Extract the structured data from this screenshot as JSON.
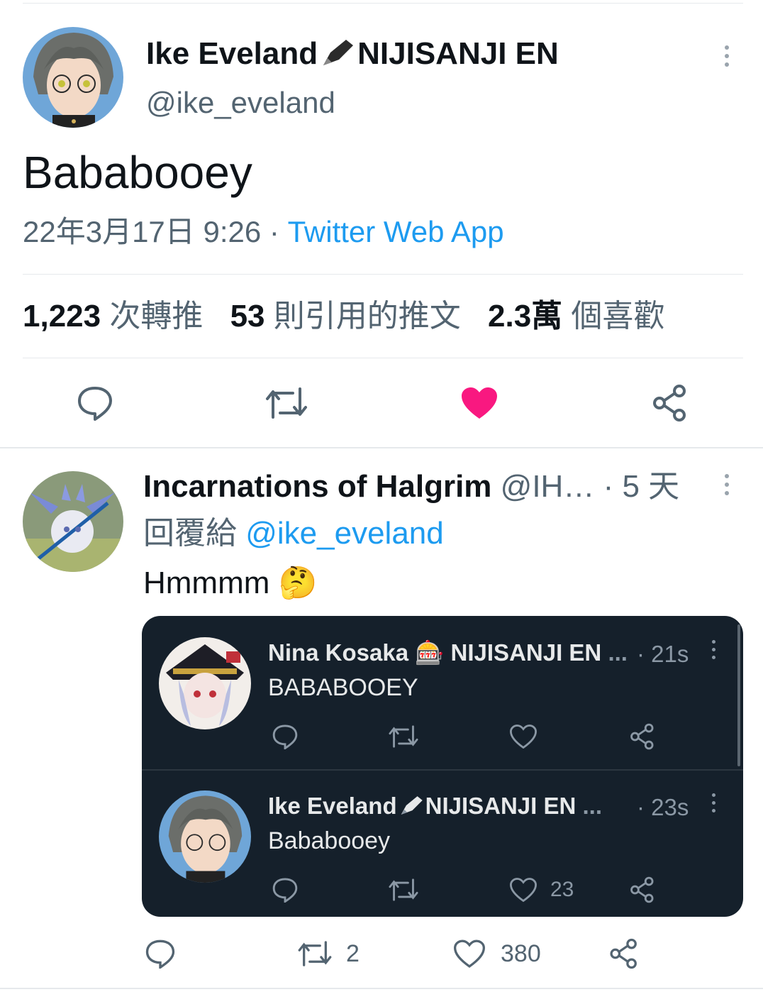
{
  "tweet": {
    "display_name": "Ike Eveland",
    "name_suffix": "NIJISANJI EN",
    "handle": "@ike_eveland",
    "text": "Bababooey",
    "date": "22年3月17日 9:26",
    "separator": "·",
    "source": "Twitter Web App",
    "stats": {
      "retweets_count": "1,223",
      "retweets_label": "次轉推",
      "quotes_count": "53",
      "quotes_label": "則引用的推文",
      "likes_count": "2.3萬",
      "likes_label": "個喜歡"
    },
    "liked": true
  },
  "reply": {
    "display_name": "Incarnations of Halgrim",
    "handle_truncated": "@IH…",
    "time": "· 5 天",
    "reply_prefix": "回覆給",
    "reply_to": "@ike_eveland",
    "text": "Hmmmm",
    "emoji": "🤔",
    "retweet_count": "2",
    "like_count": "380"
  },
  "embedded": {
    "items": [
      {
        "name": "Nina Kosaka",
        "emoji": "🎰",
        "suffix": "NIJISANJI EN",
        "ellipsis": "...",
        "time": "· 21s",
        "text": "BABABOOEY",
        "like_count": ""
      },
      {
        "name": "Ike Eveland",
        "suffix": "NIJISANJI EN",
        "ellipsis": "...",
        "time": "· 23s",
        "text": "Bababooey",
        "like_count": "23"
      }
    ]
  },
  "colors": {
    "like_pink": "#f91880",
    "link_blue": "#1d9bf0",
    "dark_card": "#15202b"
  }
}
